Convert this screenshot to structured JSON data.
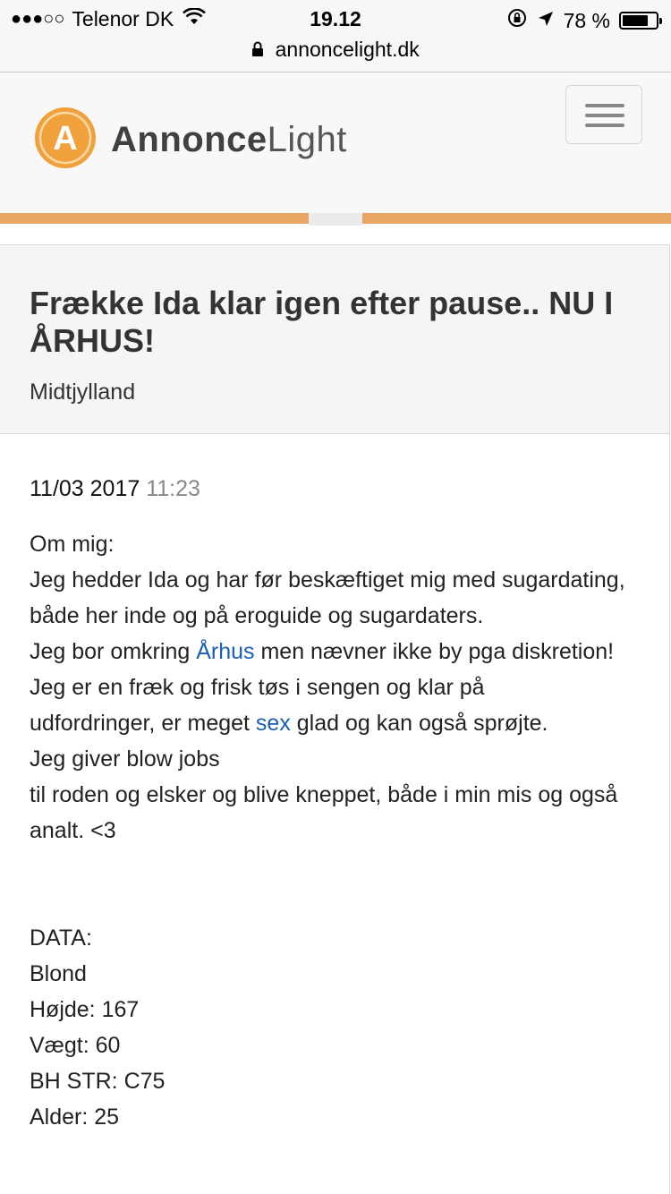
{
  "status_bar": {
    "signal": "●●●○○",
    "carrier": "Telenor DK",
    "time": "19.12",
    "battery_text": "78 %",
    "battery_level": 0.78
  },
  "url": "annoncelight.dk",
  "header": {
    "logo_letter": "A",
    "logo_part1": "Annonce",
    "logo_part2": "Light"
  },
  "ad": {
    "title": "Frække Ida klar igen efter pause.. NU I ÅRHUS!",
    "region": "Midtjylland",
    "date": "11/03 2017",
    "time": "11:23",
    "lines": {
      "l1": "Om mig:",
      "l2": "Jeg hedder Ida og har før beskæftiget mig med sugardating, både her inde og på eroguide og sugardaters.",
      "l3_pre": "Jeg bor omkring ",
      "l3_link": "Århus",
      "l3_post": " men nævner ikke by pga diskretion!",
      "l4": "Jeg er en fræk og frisk tøs i sengen og klar på",
      "l5_pre": "udfordringer, er meget ",
      "l5_link": "sex",
      "l5_post": " glad og kan også sprøjte.",
      "l6": "Jeg giver blow jobs",
      "l7": "til roden og elsker og blive kneppet, både i min mis og også analt. <3",
      "d0": "DATA:",
      "d1": "Blond",
      "d2": "Højde: 167",
      "d3": "Vægt: 60",
      "d4": "BH STR: C75",
      "d5": "Alder: 25"
    }
  },
  "colors": {
    "accent_orange": "#e9a665",
    "link_blue": "#1a5fb4"
  },
  "icons": [
    "wifi-icon",
    "lock-icon",
    "location-arrow-icon",
    "rotation-lock-icon",
    "battery-icon",
    "menu-icon"
  ]
}
